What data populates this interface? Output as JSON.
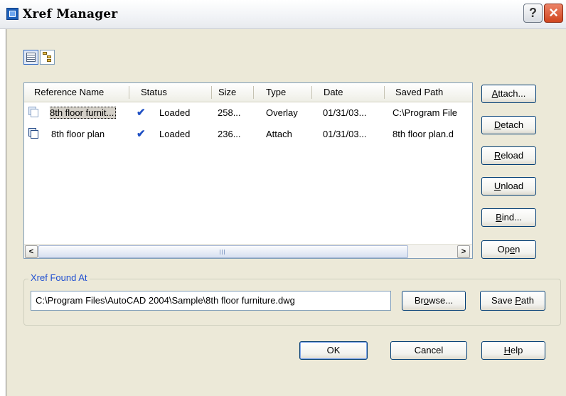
{
  "window": {
    "title": "Xref Manager",
    "help_glyph": "?",
    "close_glyph": "×"
  },
  "view_buttons": [
    {
      "name": "list-view",
      "icon": "list-view-icon",
      "selected": true
    },
    {
      "name": "tree-view",
      "icon": "tree-view-icon",
      "selected": false
    }
  ],
  "list": {
    "columns": [
      "Reference Name",
      "Status",
      "Size",
      "Type",
      "Date",
      "Saved Path"
    ],
    "rows": [
      {
        "name": "8th floor furnit...",
        "status_icon": "checkmark-icon",
        "status": "Loaded",
        "size": "258...",
        "type": "Overlay",
        "date": "01/31/03...",
        "saved_path": "C:\\Program File",
        "icon": "overlay-xref-icon",
        "selected": true
      },
      {
        "name": "8th floor plan",
        "status_icon": "checkmark-icon",
        "status": "Loaded",
        "size": "236...",
        "type": "Attach",
        "date": "01/31/03...",
        "saved_path": "8th floor plan.d",
        "icon": "attach-xref-icon",
        "selected": false
      }
    ]
  },
  "side_buttons": {
    "attach": {
      "pre": "",
      "key": "A",
      "post": "ttach..."
    },
    "detach": {
      "pre": "",
      "key": "D",
      "post": "etach"
    },
    "reload": {
      "pre": "",
      "key": "R",
      "post": "eload"
    },
    "unload": {
      "pre": "",
      "key": "U",
      "post": "nload"
    },
    "bind": {
      "pre": "",
      "key": "B",
      "post": "ind..."
    },
    "open": {
      "pre": "Op",
      "key": "e",
      "post": "n"
    }
  },
  "found_at": {
    "legend": "Xref Found At",
    "path": "C:\\Program Files\\AutoCAD 2004\\Sample\\8th floor furniture.dwg",
    "browse": {
      "pre": "Br",
      "key": "o",
      "post": "wse..."
    },
    "save_path": {
      "pre": "Save ",
      "key": "P",
      "post": "ath"
    }
  },
  "footer": {
    "ok": "OK",
    "cancel": "Cancel",
    "help": {
      "pre": "",
      "key": "H",
      "post": "elp"
    }
  }
}
